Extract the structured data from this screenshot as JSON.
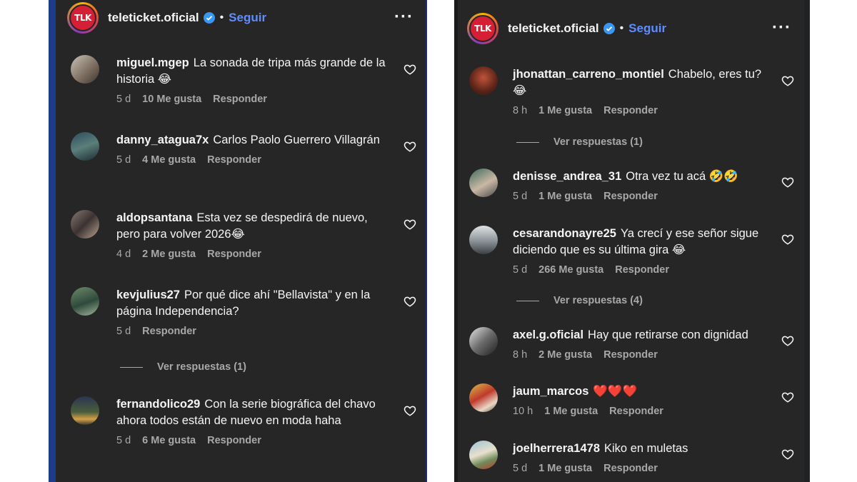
{
  "colors": {
    "panel_bg": "#262626",
    "link": "#5f8dff",
    "muted": "#a8a8a8",
    "verified": "#3897f0"
  },
  "left": {
    "header": {
      "username": "teleticket.oficial",
      "follow": "Seguir",
      "logo_text": "TLK"
    },
    "comments": [
      {
        "user": "miguel.mgep",
        "text": "La sonada de tripa más grande de la historia 😂",
        "time": "5 d",
        "likes": "10 Me gusta",
        "reply": "Responder"
      },
      {
        "user": "danny_atagua7x",
        "text": "Carlos Paolo Guerrero Villagrán",
        "time": "5 d",
        "likes": "4 Me gusta",
        "reply": "Responder"
      },
      {
        "user": "aldopsantana",
        "text": "Esta vez se despedirá de nuevo, pero para volver 2026😂",
        "time": "4 d",
        "likes": "2 Me gusta",
        "reply": "Responder"
      },
      {
        "user": "kevjulius27",
        "text": "Por qué dice ahí \"Bellavista\" y en la página Independencia?",
        "time": "5 d",
        "likes": "",
        "reply": "Responder",
        "view_replies": "Ver respuestas (1)"
      },
      {
        "user": "fernandolico29",
        "text": "Con la serie biográfica del chavo ahora todos están de nuevo en moda haha",
        "time": "5 d",
        "likes": "6 Me gusta",
        "reply": "Responder"
      }
    ]
  },
  "right": {
    "header": {
      "username": "teleticket.oficial",
      "follow": "Seguir",
      "logo_text": "TLK"
    },
    "comments": [
      {
        "user": "jhonattan_carreno_montiel",
        "text": "Chabelo, eres tu? 😂",
        "time": "8 h",
        "likes": "1 Me gusta",
        "reply": "Responder",
        "view_replies": "Ver respuestas (1)"
      },
      {
        "user": "denisse_andrea_31",
        "text": "Otra vez tu acá 🤣🤣",
        "time": "5 d",
        "likes": "1 Me gusta",
        "reply": "Responder"
      },
      {
        "user": "cesarandonayre25",
        "text": "Ya crecí y ese señor sigue diciendo que es su última gira 😂",
        "time": "5 d",
        "likes": "266 Me gusta",
        "reply": "Responder",
        "view_replies": "Ver respuestas (4)"
      },
      {
        "user": "axel.g.oficial",
        "text": "Hay que retirarse con dignidad",
        "time": "8 h",
        "likes": "2 Me gusta",
        "reply": "Responder"
      },
      {
        "user": "jaum_marcos",
        "text": "❤️❤️❤️",
        "time": "10 h",
        "likes": "1 Me gusta",
        "reply": "Responder"
      },
      {
        "user": "joelherrera1478",
        "text": "Kiko en muletas",
        "time": "5 d",
        "likes": "1 Me gusta",
        "reply": "Responder"
      }
    ]
  }
}
